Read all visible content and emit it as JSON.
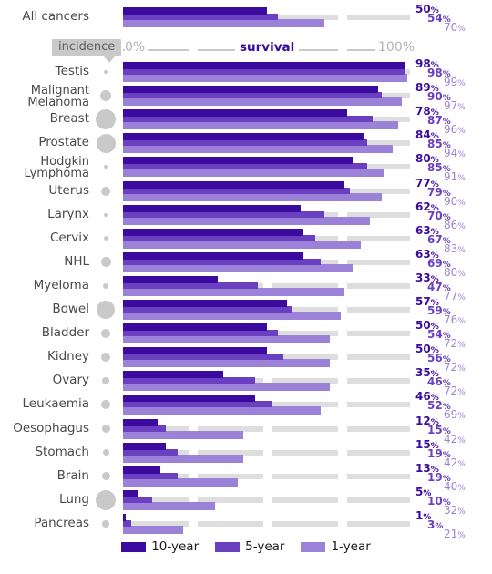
{
  "chart_data": {
    "type": "bar",
    "title": "",
    "subtitle": "",
    "xlabel": "survival",
    "ylabel": "",
    "xlim": [
      0,
      100
    ],
    "grid": true,
    "legend_position": "bottom",
    "axis": {
      "min_label": "0%",
      "max_label": "100%",
      "center_label": "survival",
      "incidence_label": "incidence"
    },
    "series": [
      {
        "name": "10-year",
        "color": "#3a0b9e"
      },
      {
        "name": "5-year",
        "color": "#6a3fc0"
      },
      {
        "name": "1-year",
        "color": "#9b81d8"
      }
    ],
    "categories": [
      "All cancers",
      "Testis",
      "Malignant Melanoma",
      "Breast",
      "Prostate",
      "Hodgkin Lymphoma",
      "Uterus",
      "Larynx",
      "Cervix",
      "NHL",
      "Myeloma",
      "Bowel",
      "Bladder",
      "Kidney",
      "Ovary",
      "Leukaemia",
      "Oesophagus",
      "Stomach",
      "Brain",
      "Lung",
      "Pancreas"
    ],
    "rows": [
      {
        "label": "All cancers",
        "label_lines": [
          "All cancers"
        ],
        "ten": 50,
        "five": 54,
        "one": 70,
        "incidence": 0,
        "separated": true
      },
      {
        "label": "Testis",
        "label_lines": [
          "Testis"
        ],
        "ten": 98,
        "five": 98,
        "one": 99,
        "incidence": 4
      },
      {
        "label": "Malignant Melanoma",
        "label_lines": [
          "Malignant",
          "Melanoma"
        ],
        "ten": 89,
        "five": 90,
        "one": 97,
        "incidence": 12
      },
      {
        "label": "Breast",
        "label_lines": [
          "Breast"
        ],
        "ten": 78,
        "five": 87,
        "one": 96,
        "incidence": 22
      },
      {
        "label": "Prostate",
        "label_lines": [
          "Prostate"
        ],
        "ten": 84,
        "five": 85,
        "one": 94,
        "incidence": 21
      },
      {
        "label": "Hodgkin Lymphoma",
        "label_lines": [
          "Hodgkin",
          "Lymphoma"
        ],
        "ten": 80,
        "five": 85,
        "one": 91,
        "incidence": 4
      },
      {
        "label": "Uterus",
        "label_lines": [
          "Uterus"
        ],
        "ten": 77,
        "five": 79,
        "one": 90,
        "incidence": 10
      },
      {
        "label": "Larynx",
        "label_lines": [
          "Larynx"
        ],
        "ten": 62,
        "five": 70,
        "one": 86,
        "incidence": 4
      },
      {
        "label": "Cervix",
        "label_lines": [
          "Cervix"
        ],
        "ten": 63,
        "five": 67,
        "one": 83,
        "incidence": 5
      },
      {
        "label": "NHL",
        "label_lines": [
          "NHL"
        ],
        "ten": 63,
        "five": 69,
        "one": 80,
        "incidence": 11
      },
      {
        "label": "Myeloma",
        "label_lines": [
          "Myeloma"
        ],
        "ten": 33,
        "five": 47,
        "one": 77,
        "incidence": 6
      },
      {
        "label": "Bowel",
        "label_lines": [
          "Bowel"
        ],
        "ten": 57,
        "five": 59,
        "one": 76,
        "incidence": 20
      },
      {
        "label": "Bladder",
        "label_lines": [
          "Bladder"
        ],
        "ten": 50,
        "five": 54,
        "one": 72,
        "incidence": 10
      },
      {
        "label": "Kidney",
        "label_lines": [
          "Kidney"
        ],
        "ten": 50,
        "five": 56,
        "one": 72,
        "incidence": 10
      },
      {
        "label": "Ovary",
        "label_lines": [
          "Ovary"
        ],
        "ten": 35,
        "five": 46,
        "one": 72,
        "incidence": 8
      },
      {
        "label": "Leukaemia",
        "label_lines": [
          "Leukaemia"
        ],
        "ten": 46,
        "five": 52,
        "one": 69,
        "incidence": 10
      },
      {
        "label": "Oesophagus",
        "label_lines": [
          "Oesophagus"
        ],
        "ten": 12,
        "five": 15,
        "one": 42,
        "incidence": 9
      },
      {
        "label": "Stomach",
        "label_lines": [
          "Stomach"
        ],
        "ten": 15,
        "five": 19,
        "one": 42,
        "incidence": 7
      },
      {
        "label": "Brain",
        "label_lines": [
          "Brain"
        ],
        "ten": 13,
        "five": 19,
        "one": 40,
        "incidence": 9
      },
      {
        "label": "Lung",
        "label_lines": [
          "Lung"
        ],
        "ten": 5,
        "five": 10,
        "one": 32,
        "incidence": 22
      },
      {
        "label": "Pancreas",
        "label_lines": [
          "Pancreas"
        ],
        "ten": 1,
        "five": 3,
        "one": 21,
        "incidence": 8
      }
    ]
  },
  "legend": {
    "items": [
      {
        "label": "10-year",
        "color": "#3a0b9e"
      },
      {
        "label": "5-year",
        "color": "#6a3fc0"
      },
      {
        "label": "1-year",
        "color": "#9b81d8"
      }
    ]
  }
}
